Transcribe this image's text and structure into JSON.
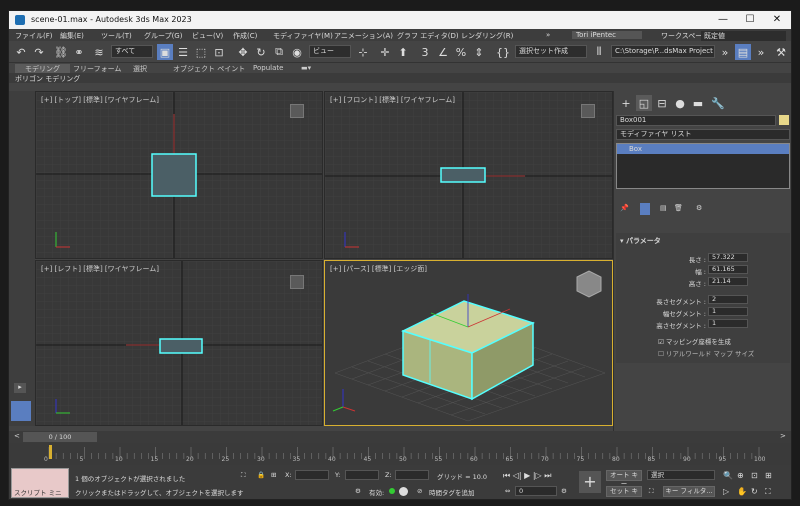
{
  "titlebar": {
    "title": "scene-01.max - Autodesk 3ds Max 2023",
    "minimize": "—",
    "maximize": "☐",
    "close": "✕"
  },
  "menu": {
    "items": [
      "ファイル(F)",
      "編集(E)",
      "ツール(T)",
      "グループ(G)",
      "ビュー(V)",
      "作成(C)",
      "モディファイヤ(M)",
      "アニメーション(A)",
      "グラフ エディタ(D)",
      "レンダリング(R)"
    ],
    "more": "»",
    "user": "Tori iPentec",
    "workspace_label": "ワークスペース:",
    "workspace_value": "既定値"
  },
  "toolbar": {
    "filter": "すべて",
    "view": "ビュー",
    "selset": "選択セット作成",
    "project": "C:\\Storage\\P...dsMax Project"
  },
  "ribbon": {
    "tabs": [
      "モデリング",
      "フリーフォーム",
      "選択",
      "オブジェクト ペイント",
      "Populate"
    ],
    "sub": "ポリゴン モデリング"
  },
  "viewports": {
    "top": "[+] [トップ] [標準] [ワイヤフレーム]",
    "front": "[+] [フロント] [標準] [ワイヤフレーム]",
    "left": "[+] [レフト] [標準] [ワイヤフレーム]",
    "persp": "[+] [パース] [標準] [エッジ面]"
  },
  "cmdpanel": {
    "object_name": "Box001",
    "modlist": "モディファイヤ リスト",
    "stack_item": "Box",
    "rollout": "パラメータ",
    "params": [
      {
        "label": "長さ :",
        "value": "57.322"
      },
      {
        "label": "幅 :",
        "value": "61.165"
      },
      {
        "label": "高さ :",
        "value": "21.14"
      }
    ],
    "segs": [
      {
        "label": "長さセグメント :",
        "value": "2"
      },
      {
        "label": "幅セグメント :",
        "value": "1"
      },
      {
        "label": "高さセグメント :",
        "value": "1"
      }
    ],
    "check1": "マッピング座標を生成",
    "check2": "リアルワールド マップ サイズ"
  },
  "timeline": {
    "frame": "0 / 100",
    "ticks": [
      "0",
      "5",
      "10",
      "15",
      "20",
      "25",
      "30",
      "35",
      "40",
      "45",
      "50",
      "55",
      "60",
      "65",
      "70",
      "75",
      "80",
      "85",
      "90",
      "95",
      "100"
    ]
  },
  "statusbar": {
    "script": "スクリプト ミニ リス",
    "msg1": "1 個のオブジェクトが選択されました",
    "msg2": "クリックまたはドラッグして、オブジェクトを選択します",
    "x": "X:",
    "y": "Y:",
    "z": "Z:",
    "grid": "グリッド = 10.0",
    "enabled": "有効:",
    "addtime": "時間タグを追加",
    "autokey": "オート キー",
    "setkey": "セット キー",
    "select": "選択",
    "keyfilter": "キー フィルタ...",
    "frame": "0"
  }
}
